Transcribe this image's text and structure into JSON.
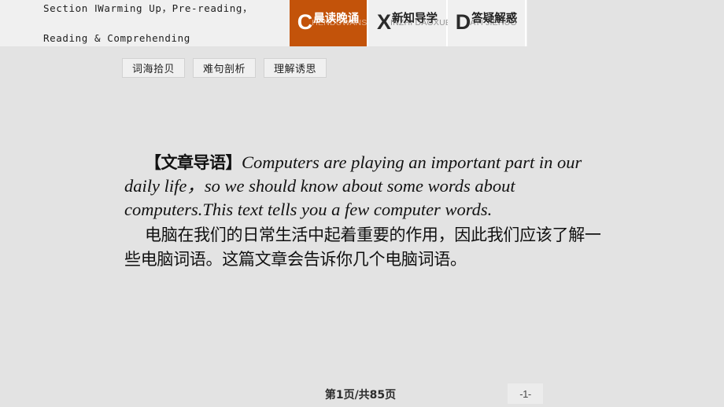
{
  "header": {
    "section_label": "Section Ⅰ",
    "section_sub_line1": "Warming Up，Pre-reading，",
    "section_sub_line2": "Reading & Comprehending",
    "tabs": [
      {
        "initial": "C",
        "chinese": "晨读晚诵",
        "pinyin": "HENDUWANSONG",
        "active": true,
        "accent": "#c3530a"
      },
      {
        "initial": "X",
        "chinese": "新知导学",
        "pinyin": "INZHI DAOXUE",
        "active": false,
        "accent": "#f0f0f0"
      },
      {
        "initial": "D",
        "chinese": "答疑解惑",
        "pinyin": "AYI JIEHUO",
        "active": false,
        "accent": "#f0f0f0"
      }
    ]
  },
  "subtabs": [
    {
      "label": "词海拾贝"
    },
    {
      "label": "难句剖析"
    },
    {
      "label": "理解诱思"
    }
  ],
  "main": {
    "lead_cn": "【文章导语】",
    "english": "Computers are playing an important part in our daily life，so we should know about some words about computers.This text tells you a few computer words.",
    "chinese": "电脑在我们的日常生活中起着重要的作用，因此我们应该了解一些电脑词语。这篇文章会告诉你几个电脑词语。"
  },
  "footer": {
    "page_counter": "第1页/共85页",
    "page_badge": "-1-"
  }
}
